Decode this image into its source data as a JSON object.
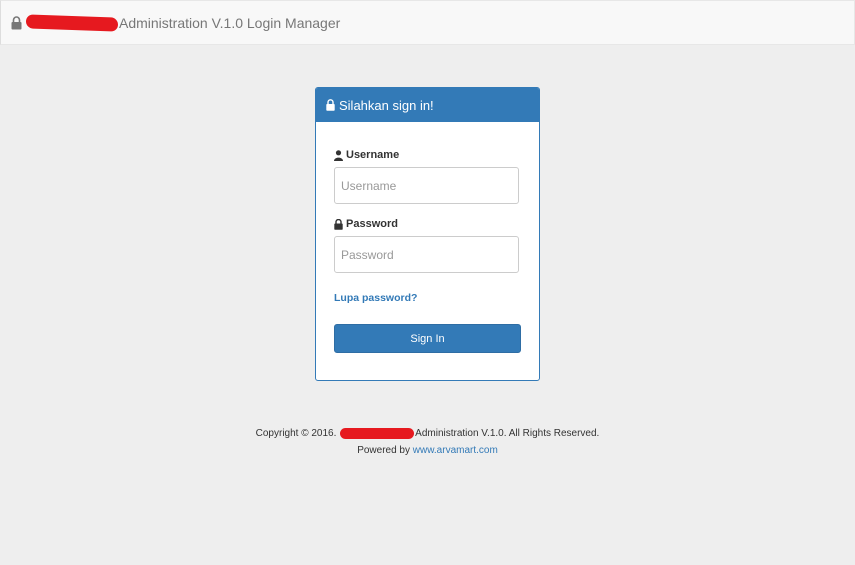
{
  "navbar": {
    "brand_text": "Administration V.1.0 Login Manager",
    "icon": "lock-icon"
  },
  "panel": {
    "title": "Silahkan sign in!",
    "title_icon": "lock-icon",
    "username": {
      "label": "Username",
      "icon": "user-icon",
      "placeholder": "Username",
      "value": ""
    },
    "password": {
      "label": "Password",
      "icon": "lock-icon",
      "placeholder": "Password",
      "value": ""
    },
    "forgot_link": "Lupa password?",
    "signin_label": "Sign In"
  },
  "footer": {
    "copyright_prefix": "Copyright © 2016.",
    "copyright_suffix": "Administration V.1.0. All Rights Reserved.",
    "powered_prefix": "Powered by",
    "powered_link": "www.arvamart.com"
  },
  "colors": {
    "primary": "#337ab7",
    "background": "#eeeeee",
    "navbar_bg": "#f8f8f8",
    "redaction": "#e6191f"
  }
}
